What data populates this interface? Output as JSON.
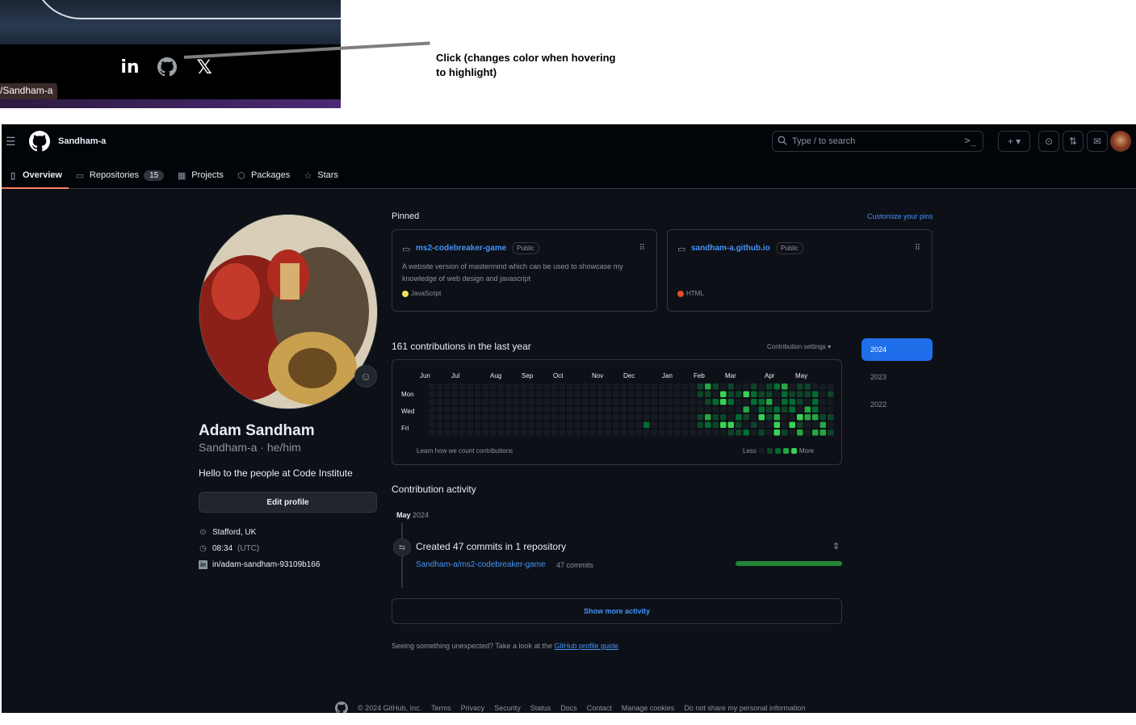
{
  "annotation": {
    "url_tooltip": "/Sandham-a",
    "callout_text": "Click (changes color when hovering to highlight)",
    "social_icons": [
      "linkedin-icon",
      "github-icon",
      "x-icon"
    ]
  },
  "header": {
    "username": "Sandham-a",
    "search_placeholder": "Type / to search"
  },
  "tabs": [
    {
      "label": "Overview",
      "icon": "book-icon",
      "active": true
    },
    {
      "label": "Repositories",
      "icon": "repo-icon",
      "count": "15"
    },
    {
      "label": "Projects",
      "icon": "table-icon"
    },
    {
      "label": "Packages",
      "icon": "package-icon"
    },
    {
      "label": "Stars",
      "icon": "star-icon"
    }
  ],
  "profile": {
    "name": "Adam Sandham",
    "login": "Sandham-a · he/him",
    "bio": "Hello to the people at Code Institute",
    "edit_label": "Edit profile",
    "location": "Stafford, UK",
    "time": "08:34",
    "timezone": "(UTC)",
    "linkedin": "in/adam-sandham-93109b166"
  },
  "pinned": {
    "title": "Pinned",
    "customize": "Customize your pins",
    "cards": [
      {
        "name": "ms2-codebreaker-game",
        "visibility": "Public",
        "description": "A website version of mastermind which can be used to showcase my knowledge of web design and javascript",
        "language": "JavaScript",
        "language_color": "#f1e05a"
      },
      {
        "name": "sandham-a.github.io",
        "visibility": "Public",
        "description": "",
        "language": "HTML",
        "language_color": "#e34c26"
      }
    ]
  },
  "contributions": {
    "title": "161 contributions in the last year",
    "settings": "Contribution settings ▾",
    "months": [
      "Jun",
      "Jul",
      "Aug",
      "Sep",
      "Oct",
      "Nov",
      "Dec",
      "Jan",
      "Feb",
      "Mar",
      "Apr",
      "May"
    ],
    "days": [
      "Mon",
      "Wed",
      "Fri"
    ],
    "learn": "Learn how we count contributions",
    "less": "Less",
    "more": "More",
    "colors": [
      "#161b22",
      "#0e4429",
      "#006d32",
      "#26a641",
      "#39d353"
    ],
    "years": [
      "2024",
      "2023",
      "2022"
    ],
    "active_year": "2024"
  },
  "activity": {
    "title": "Contribution activity",
    "month": "May",
    "year": "2024",
    "heading": "Created 47 commits in 1 repository",
    "repo": "Sandham-a/ms2-codebreaker-game",
    "commits": "47 commits",
    "bar_fraction": 1.0,
    "show_more": "Show more activity",
    "unexpected_text": "Seeing something unexpected? Take a look at the",
    "guide_link": "GitHub profile guide"
  },
  "footer": {
    "links": [
      "© 2024 GitHub, Inc.",
      "Terms",
      "Privacy",
      "Security",
      "Status",
      "Docs",
      "Contact",
      "Manage cookies",
      "Do not share my personal information"
    ]
  }
}
